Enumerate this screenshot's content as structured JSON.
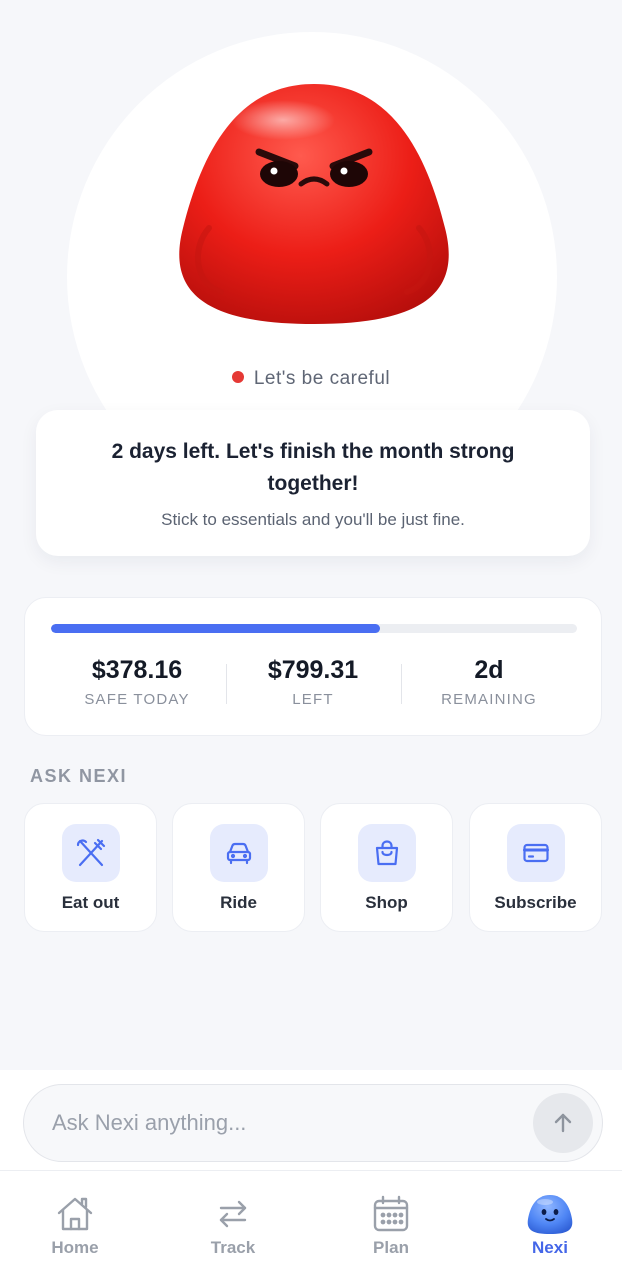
{
  "hero": {
    "status_text": "Let's be careful",
    "status_color": "#e53935",
    "mascot_mood": "angry"
  },
  "message": {
    "title": "2 days left. Let's finish the month strong together!",
    "subtitle": "Stick to essentials and you'll be just fine."
  },
  "budget": {
    "progress_fraction": 0.625,
    "progress_color": "#4a6ef2",
    "stats": [
      {
        "value": "$378.16",
        "label": "SAFE TODAY"
      },
      {
        "value": "$799.31",
        "label": "LEFT"
      },
      {
        "value": "2d",
        "label": "REMAINING"
      }
    ]
  },
  "ask_nexi": {
    "section_label": "ASK NEXI",
    "actions": [
      {
        "label": "Eat out",
        "icon": "fork-knife-icon"
      },
      {
        "label": "Ride",
        "icon": "car-icon"
      },
      {
        "label": "Shop",
        "icon": "shopping-bag-icon"
      },
      {
        "label": "Subscribe",
        "icon": "credit-card-icon"
      }
    ]
  },
  "composer": {
    "placeholder": "Ask Nexi anything..."
  },
  "tabs": [
    {
      "label": "Home",
      "icon": "home-icon",
      "active": false
    },
    {
      "label": "Track",
      "icon": "transfer-arrows-icon",
      "active": false
    },
    {
      "label": "Plan",
      "icon": "calendar-icon",
      "active": false
    },
    {
      "label": "Nexi",
      "icon": "nexi-mascot-icon",
      "active": true
    }
  ],
  "colors": {
    "accent": "#4466e8",
    "background": "#f6f7fa"
  }
}
